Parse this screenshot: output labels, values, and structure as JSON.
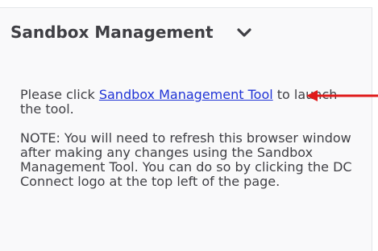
{
  "widget": {
    "title": "Sandbox Management",
    "collapse_icon": "chevron-down-icon"
  },
  "content": {
    "intro_prefix": "Please click ",
    "link_text": "Sandbox Management Tool",
    "intro_suffix": " to launch the tool.",
    "note": "NOTE: You will need to refresh this browser window after making any changes using the Sandbox Management Tool. You can do so by clicking the DC Connect logo at the top left of the page."
  },
  "annotation": {
    "icon": "red-arrow-icon",
    "color": "#e01b1b"
  },
  "colors": {
    "link": "#1f33d6",
    "text": "#3f3f44",
    "panel_bg": "#f9f9fa"
  }
}
